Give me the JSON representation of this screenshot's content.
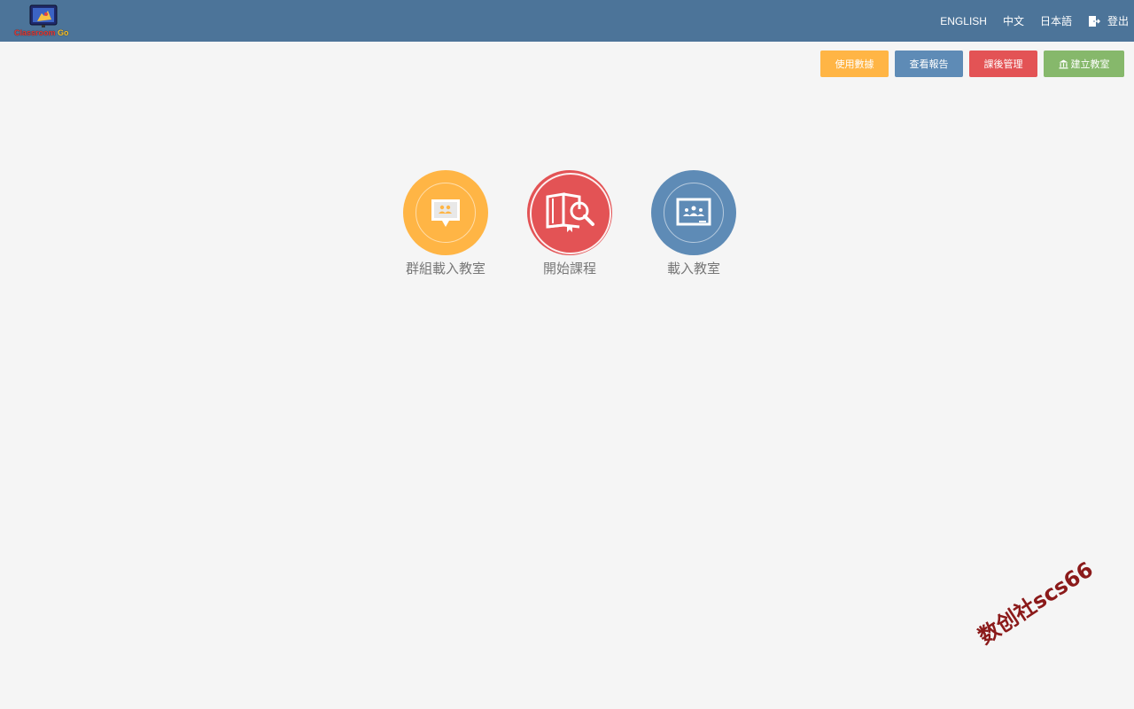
{
  "header": {
    "logo_text_main": "Classroom",
    "logo_text_accent": "Go",
    "nav": [
      {
        "label": "ENGLISH"
      },
      {
        "label": "中文"
      },
      {
        "label": "日本語"
      },
      {
        "label": "登出",
        "icon": "logout-icon"
      }
    ]
  },
  "actions": {
    "usage_data": "使用數據",
    "view_report": "查看報告",
    "after_class": "課後管理",
    "create_classroom": "建立教室",
    "create_classroom_icon": "bank-icon"
  },
  "tiles": [
    {
      "label": "群組載入教室",
      "icon": "group-chat-icon",
      "color": "#ffb545"
    },
    {
      "label": "開始課程",
      "icon": "book-search-icon",
      "color": "#e35355"
    },
    {
      "label": "載入教室",
      "icon": "classroom-board-icon",
      "color": "#5e8bb6"
    }
  ],
  "colors": {
    "header_bg": "#4c7499",
    "page_bg": "#f5f5f5",
    "yellow": "#ffb545",
    "blue": "#5e8bb6",
    "red": "#e35355",
    "green": "#86b86b"
  },
  "watermark": "数创社scs66"
}
